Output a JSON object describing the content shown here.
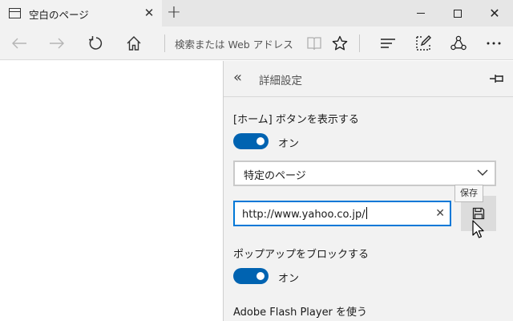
{
  "tab": {
    "title": "空白のページ",
    "icon": "page-icon",
    "close_icon": "close-icon"
  },
  "new_tab_icon": "plus-icon",
  "window": {
    "minimize_icon": "minimize-icon",
    "maximize_icon": "maximize-icon",
    "close_icon": "close-icon"
  },
  "nav": {
    "back_icon": "back-arrow-icon",
    "forward_icon": "forward-arrow-icon",
    "refresh_icon": "refresh-icon",
    "home_icon": "home-icon",
    "address_placeholder": "検索または Web アドレスを入",
    "reading_view_icon": "book-icon",
    "favorite_icon": "star-icon",
    "hub_icon": "hub-icon",
    "note_icon": "pen-note-icon",
    "share_icon": "share-icon",
    "more_icon": "more-icon"
  },
  "panel": {
    "back_icon": "double-chevron-left-icon",
    "title": "詳細設定",
    "pin_icon": "pin-icon",
    "home_button_label": "[ホーム] ボタンを表示する",
    "home_toggle_text": "オン",
    "home_toggle_on": true,
    "page_select_value": "特定のページ",
    "url_value": "http://www.yahoo.co.jp/",
    "clear_icon": "clear-icon",
    "save_icon": "save-icon",
    "save_tooltip": "保存",
    "popup_label": "ポップアップをブロックする",
    "popup_toggle_text": "オン",
    "popup_toggle_on": true,
    "flash_label": "Adobe Flash Player を使う"
  },
  "colors": {
    "accent": "#0078d7",
    "toggle_on": "#0063b1",
    "panel_bg": "#f2f2f2",
    "chrome_bg": "#e6e6e6"
  }
}
